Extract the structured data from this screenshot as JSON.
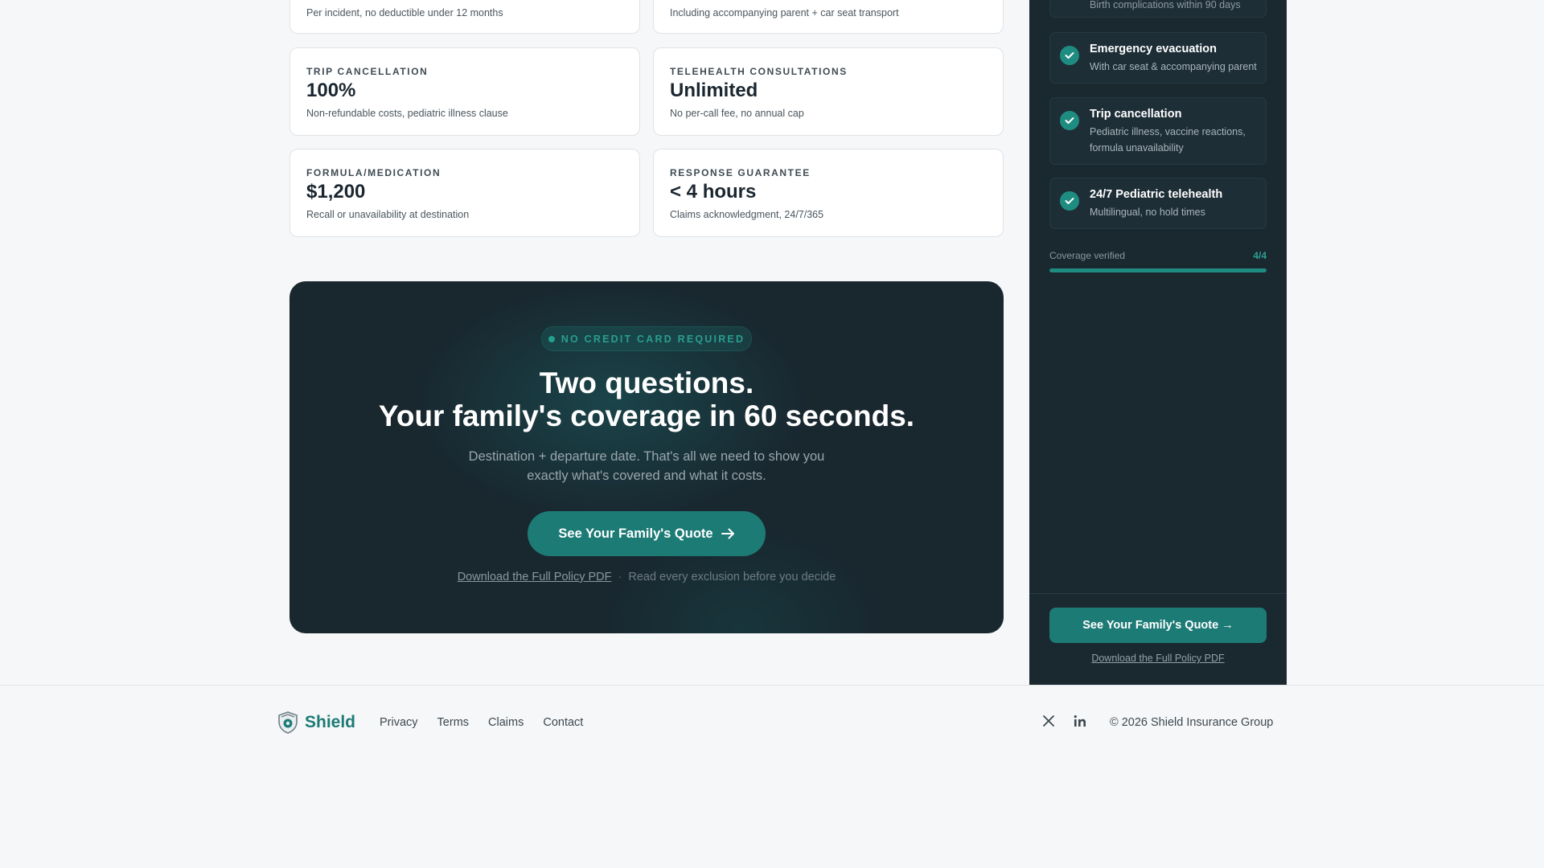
{
  "coverage_cards": [
    {
      "label": "",
      "value": "",
      "desc": "Per incident, no deductible under 12 months"
    },
    {
      "label": "",
      "value": "",
      "desc": "Including accompanying parent + car seat transport"
    },
    {
      "label": "TRIP CANCELLATION",
      "value": "100%",
      "desc": "Non-refundable costs, pediatric illness clause"
    },
    {
      "label": "TELEHEALTH CONSULTATIONS",
      "value": "Unlimited",
      "desc": "No per-call fee, no annual cap"
    },
    {
      "label": "FORMULA/MEDICATION",
      "value": "$1,200",
      "desc": "Recall or unavailability at destination"
    },
    {
      "label": "RESPONSE GUARANTEE",
      "value": "< 4 hours",
      "desc": "Claims acknowledgment, 24/7/365"
    }
  ],
  "cta": {
    "badge": "NO CREDIT CARD REQUIRED",
    "title_line1": "Two questions.",
    "title_line2": "Your family's coverage in 60 seconds.",
    "subtitle": "Destination + departure date. That's all we need to show you exactly what's covered and what it costs.",
    "button_label": "See Your Family's Quote",
    "pdf_link": "Download the Full Policy PDF",
    "separator": "·",
    "note": "Read every exclusion before you decide"
  },
  "sidebar": {
    "partial_item_desc": "Birth complications within 90 days",
    "items": [
      {
        "title": "Emergency evacuation",
        "desc": "With car seat & accompanying parent"
      },
      {
        "title": "Trip cancellation",
        "desc": "Pediatric illness, vaccine reactions, formula unavailability"
      },
      {
        "title": "24/7 Pediatric telehealth",
        "desc": "Multilingual, no hold times"
      }
    ],
    "progress_label": "Coverage verified",
    "progress_count": "4/4",
    "progress_fraction": 1.0,
    "button_label": "See Your Family's Quote →",
    "pdf_link": "Download the Full Policy PDF"
  },
  "footer": {
    "brand": "Shield",
    "nav": [
      "Privacy",
      "Terms",
      "Claims",
      "Contact"
    ],
    "social_icons": [
      "x-icon",
      "linkedin-icon"
    ],
    "copyright": "© 2026 Shield Insurance Group"
  },
  "colors": {
    "accent": "#1d7b76",
    "dark_panel": "#19272f",
    "sidebar_bg": "#1a2830",
    "check": "#1f8c82"
  }
}
